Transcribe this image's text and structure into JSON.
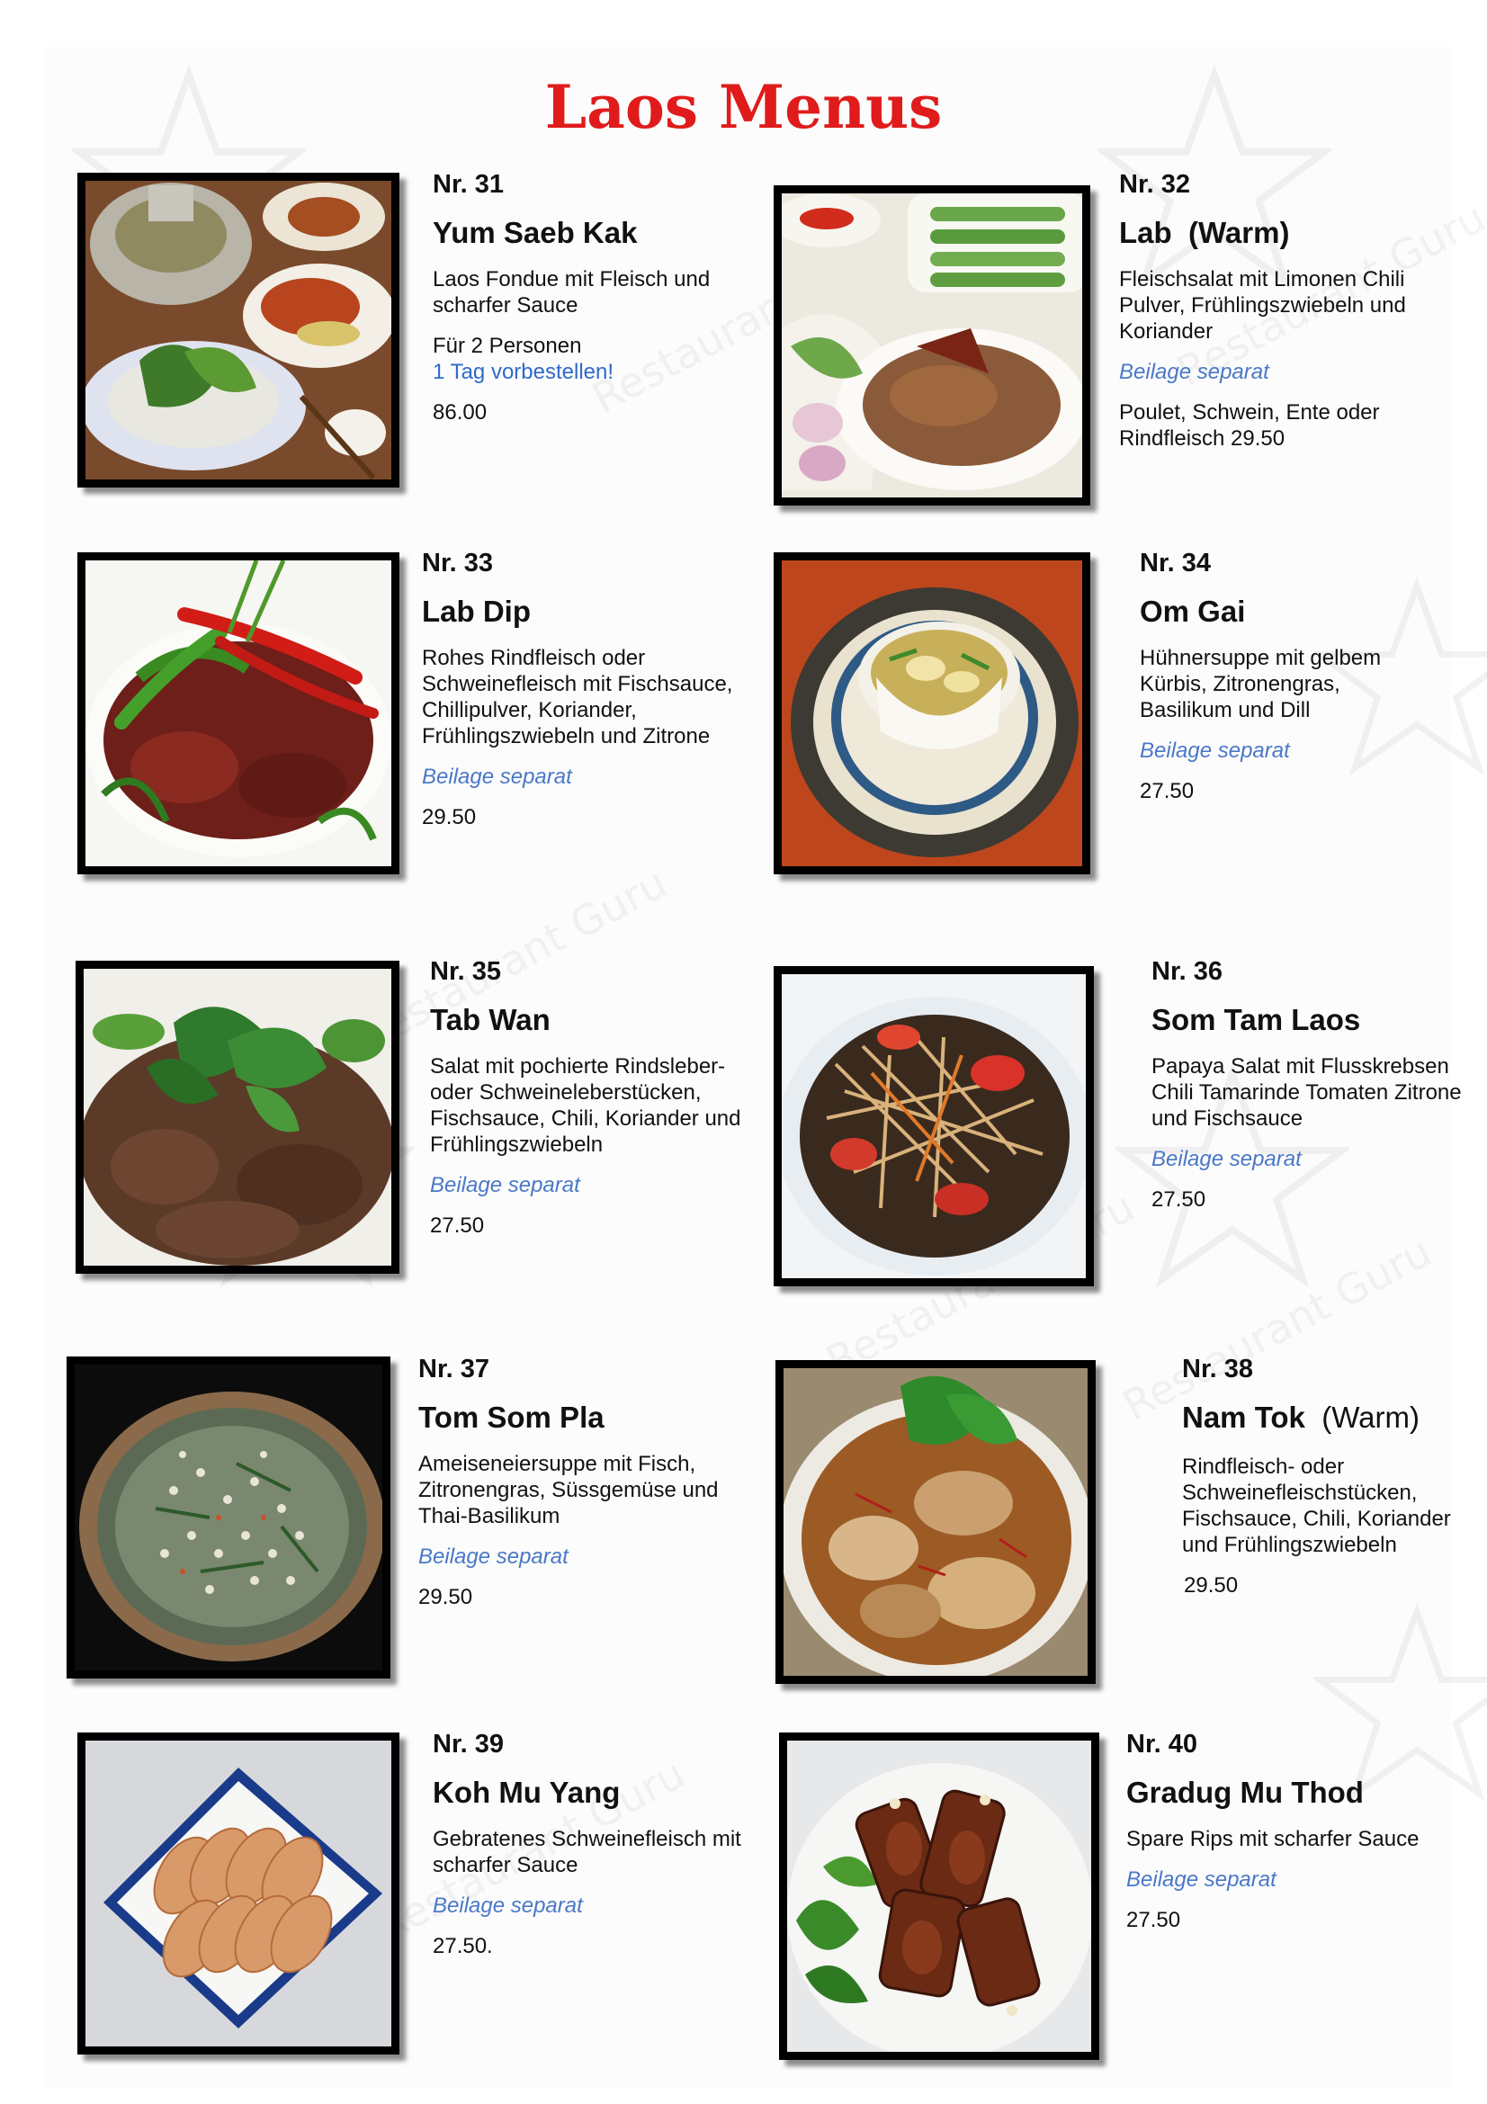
{
  "page": {
    "title": "Laos Menus"
  },
  "watermark": "Restaurant Guru",
  "items": [
    {
      "nr": "Nr. 31",
      "name": "Yum Saeb Kak",
      "desc": "Laos Fondue mit Fleisch und scharfer Sauce",
      "persons": "Für 2 Personen",
      "note": "1 Tag vorbestellen!",
      "price": "86.00"
    },
    {
      "nr": "Nr. 32",
      "name": "Lab  (Warm)",
      "desc": "Fleischsalat mit Limonen Chili Pulver, Frühlingszwiebeln und Koriander",
      "beilage": "Beilage separat",
      "price_line1": "Poulet, Schwein, Ente oder",
      "price_line2": "Rindfleisch 29.50"
    },
    {
      "nr": "Nr. 33",
      "name": "Lab Dip",
      "desc": "Rohes Rindfleisch oder Schweinefleisch mit Fischsauce, Chillipulver, Koriander, Frühlingszwiebeln und Zitrone",
      "beilage": "Beilage separat",
      "price": "29.50"
    },
    {
      "nr": "Nr. 34",
      "name": "Om Gai",
      "desc": "Hühnersuppe mit gelbem Kürbis, Zitronengras, Basilikum und Dill",
      "beilage": "Beilage separat",
      "price": "27.50"
    },
    {
      "nr": "Nr. 35",
      "name": "Tab Wan",
      "desc": "Salat mit pochierte Rindsleber- oder Schweineleberstücken, Fischsauce, Chili, Koriander und Frühlingszwiebeln",
      "beilage": "Beilage separat",
      "price": "27.50"
    },
    {
      "nr": "Nr. 36",
      "name": "Som Tam Laos",
      "desc": "Papaya Salat mit Flusskrebsen Chili Tamarinde Tomaten Zitrone und Fischsauce",
      "beilage": "Beilage separat",
      "price": "27.50"
    },
    {
      "nr": "Nr. 37",
      "name": "Tom Som Pla",
      "desc": "Ameiseneiersuppe mit Fisch, Zitronengras, Süssgemüse und Thai-Basilikum",
      "beilage": "Beilage separat",
      "price": "29.50"
    },
    {
      "nr": "Nr. 38",
      "name": "Nam Tok",
      "name_suffix": "(Warm)",
      "desc": "Rindfleisch- oder Schweinefleischstücken, Fischsauce, Chili, Koriander und Frühlingszwiebeln",
      "price": "29.50"
    },
    {
      "nr": "Nr. 39",
      "name": "Koh Mu Yang",
      "desc": "Gebratenes Schweinefleisch mit scharfer Sauce",
      "beilage": "Beilage separat",
      "price": "27.50."
    },
    {
      "nr": "Nr. 40",
      "name": "Gradug Mu Thod",
      "desc": "Spare Rips mit scharfer Sauce",
      "beilage": "Beilage separat",
      "price": "27.50"
    }
  ]
}
